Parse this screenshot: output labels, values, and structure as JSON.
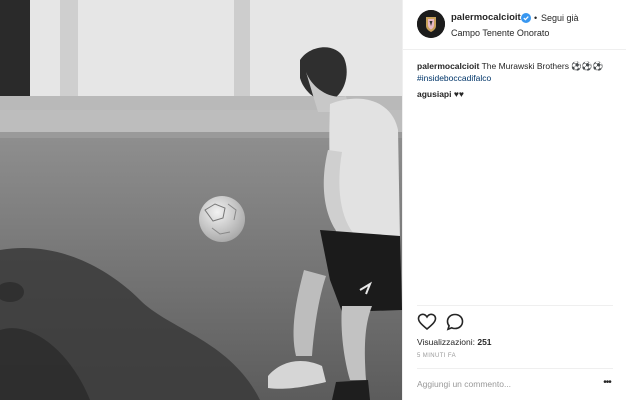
{
  "post": {
    "username": "palermocalcioit",
    "separator": "•",
    "follow_label": "Segui già",
    "location": "Campo Tenente Onorato",
    "caption_text": "The Murawski Brothers",
    "caption_emoji": "⚽⚽⚽",
    "hashtag": "#insideboccadifalco",
    "comment_username": "agusiapi",
    "comment_text": "♥♥",
    "views_label": "Visualizzazioni:",
    "views_count": "251",
    "time_ago": "5 MINUTI FA",
    "add_comment_placeholder": "Aggiungi un commento...",
    "more_label": "•••"
  },
  "icons": {
    "like": "heart-icon",
    "comment": "comment-bubble-icon",
    "verified": "verified-badge-icon",
    "more": "more-options-icon"
  },
  "colors": {
    "verified": "#3897f0",
    "hashtag": "#003569",
    "muted": "#999999",
    "text": "#262626"
  }
}
